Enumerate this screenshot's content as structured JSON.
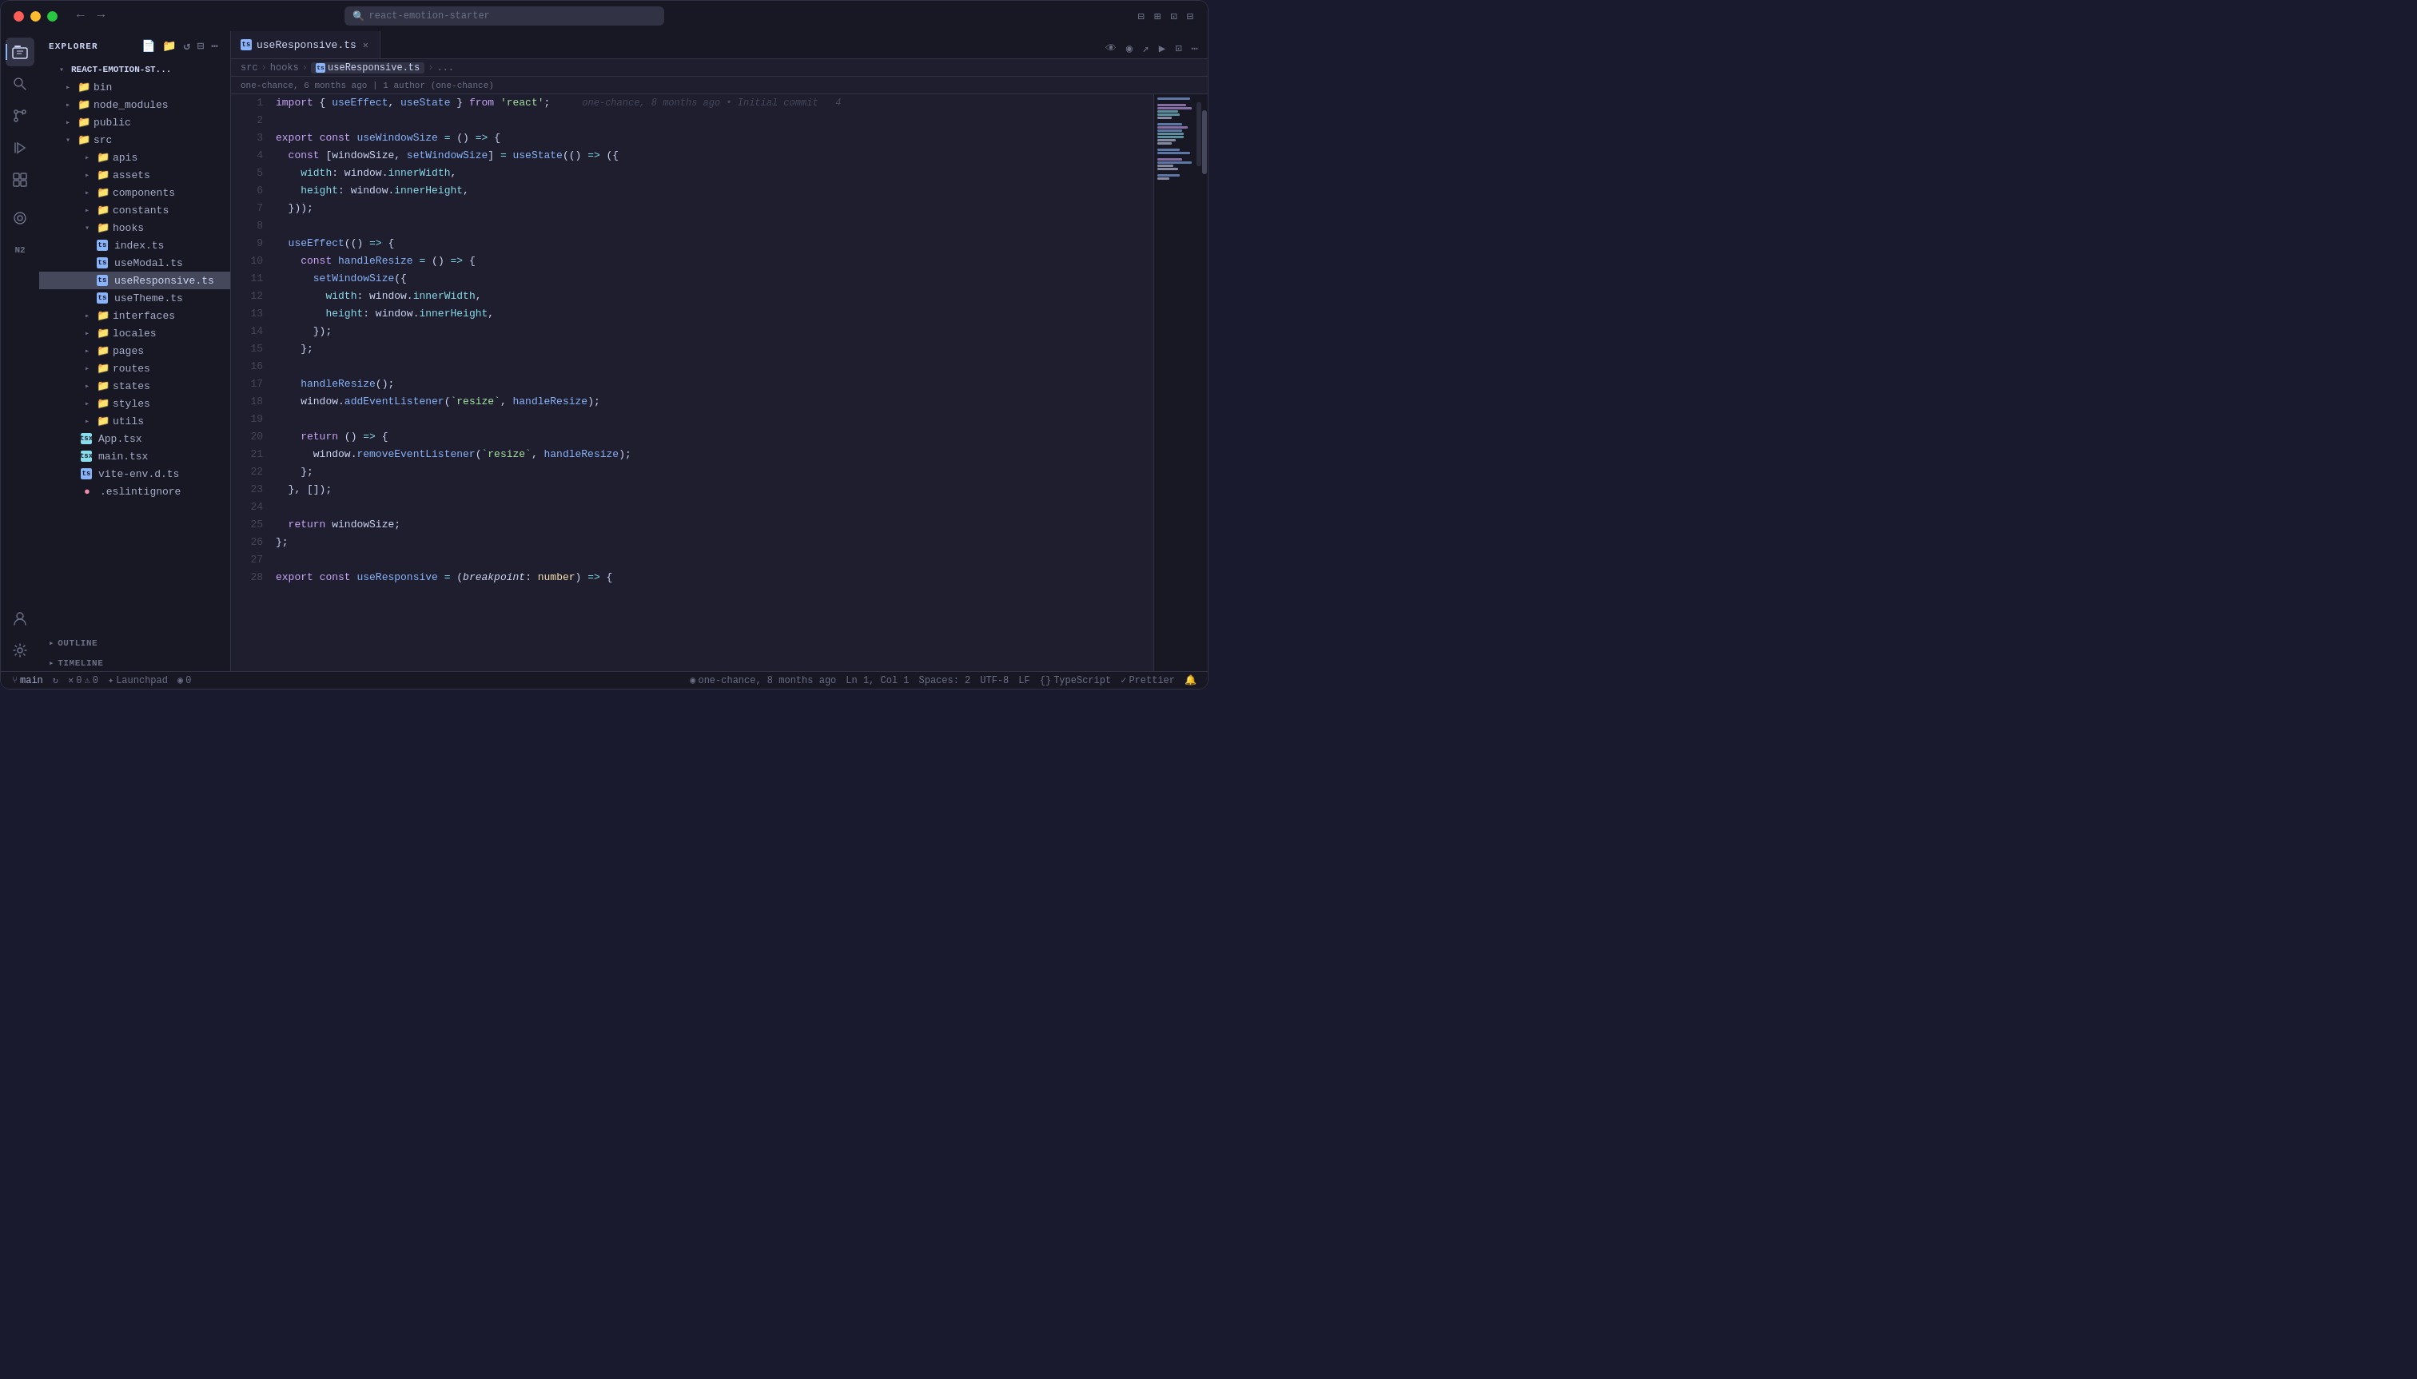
{
  "titlebar": {
    "search_placeholder": "react-emotion-starter",
    "nav_back": "←",
    "nav_forward": "→"
  },
  "activity_bar": {
    "items": [
      {
        "name": "explorer",
        "icon": "⬜",
        "active": true
      },
      {
        "name": "search",
        "icon": "🔍"
      },
      {
        "name": "source-control",
        "icon": "⑂"
      },
      {
        "name": "run-debug",
        "icon": "▷"
      },
      {
        "name": "extensions",
        "icon": "⊞"
      },
      {
        "name": "remote-explorer",
        "icon": "⊙"
      },
      {
        "name": "copilot",
        "icon": "◎"
      },
      {
        "name": "accounts",
        "icon": "👤"
      },
      {
        "name": "settings",
        "icon": "⚙"
      }
    ]
  },
  "sidebar": {
    "title": "EXPLORER",
    "root": "REACT-EMOTION-ST...",
    "tree": [
      {
        "id": "bin",
        "label": "bin",
        "type": "folder",
        "indent": 1,
        "expanded": false
      },
      {
        "id": "node_modules",
        "label": "node_modules",
        "type": "folder",
        "indent": 1,
        "expanded": false
      },
      {
        "id": "public",
        "label": "public",
        "type": "folder",
        "indent": 1,
        "expanded": false
      },
      {
        "id": "src",
        "label": "src",
        "type": "folder",
        "indent": 1,
        "expanded": true
      },
      {
        "id": "apis",
        "label": "apis",
        "type": "folder",
        "indent": 2,
        "expanded": false
      },
      {
        "id": "assets",
        "label": "assets",
        "type": "folder",
        "indent": 2,
        "expanded": false
      },
      {
        "id": "components",
        "label": "components",
        "type": "folder",
        "indent": 2,
        "expanded": false
      },
      {
        "id": "constants",
        "label": "constants",
        "type": "folder",
        "indent": 2,
        "expanded": false
      },
      {
        "id": "hooks",
        "label": "hooks",
        "type": "folder",
        "indent": 2,
        "expanded": true,
        "special": "hooks"
      },
      {
        "id": "index_ts",
        "label": "index.ts",
        "type": "file-ts",
        "indent": 3
      },
      {
        "id": "useModal_ts",
        "label": "useModal.ts",
        "type": "file-ts",
        "indent": 3
      },
      {
        "id": "useResponsive_ts",
        "label": "useResponsive.ts",
        "type": "file-ts",
        "indent": 3,
        "active": true
      },
      {
        "id": "useTheme_ts",
        "label": "useTheme.ts",
        "type": "file-ts",
        "indent": 3
      },
      {
        "id": "interfaces",
        "label": "interfaces",
        "type": "folder",
        "indent": 2,
        "expanded": false
      },
      {
        "id": "locales",
        "label": "locales",
        "type": "folder",
        "indent": 2,
        "expanded": false
      },
      {
        "id": "pages",
        "label": "pages",
        "type": "folder",
        "indent": 2,
        "expanded": false
      },
      {
        "id": "routes",
        "label": "routes",
        "type": "folder",
        "indent": 2,
        "expanded": false
      },
      {
        "id": "states",
        "label": "states",
        "type": "folder",
        "indent": 2,
        "expanded": false
      },
      {
        "id": "styles",
        "label": "styles",
        "type": "folder",
        "indent": 2,
        "expanded": false
      },
      {
        "id": "utils",
        "label": "utils",
        "type": "folder",
        "indent": 2,
        "expanded": false
      },
      {
        "id": "app_tsx",
        "label": "App.tsx",
        "type": "file-tsx",
        "indent": 2
      },
      {
        "id": "main_tsx",
        "label": "main.tsx",
        "type": "file-tsx",
        "indent": 2
      },
      {
        "id": "vite_env",
        "label": "vite-env.d.ts",
        "type": "file-ts",
        "indent": 2
      },
      {
        "id": "eslintrc",
        "label": ".eslintignore",
        "type": "file-dot",
        "indent": 2
      }
    ],
    "outline_label": "OUTLINE",
    "timeline_label": "TIMELINE"
  },
  "tab_bar": {
    "tabs": [
      {
        "id": "useResponsive",
        "label": "useResponsive.ts",
        "active": true,
        "icon": "ts"
      }
    ],
    "actions": [
      "👁",
      "👁‍🗨",
      "🔀",
      "▶",
      "⊟",
      "⋯"
    ]
  },
  "breadcrumb": {
    "parts": [
      "src",
      "hooks",
      "useResponsive.ts",
      "..."
    ]
  },
  "blame_info": {
    "text": "one-chance, 6 months ago | 1 author (one-chance)"
  },
  "code": {
    "lines": [
      {
        "num": 1,
        "content": "import { useEffect, useState } from 'react';",
        "blame": "one-chance, 8 months ago • Initial commit   4"
      },
      {
        "num": 2,
        "content": ""
      },
      {
        "num": 3,
        "content": "export const useWindowSize = () => {"
      },
      {
        "num": 4,
        "content": "  const [windowSize, setWindowSize] = useState(() => ({"
      },
      {
        "num": 5,
        "content": "    width: window.innerWidth,"
      },
      {
        "num": 6,
        "content": "    height: window.innerHeight,"
      },
      {
        "num": 7,
        "content": "  }));"
      },
      {
        "num": 8,
        "content": ""
      },
      {
        "num": 9,
        "content": "  useEffect(() => {"
      },
      {
        "num": 10,
        "content": "    const handleResize = () => {"
      },
      {
        "num": 11,
        "content": "      setWindowSize({"
      },
      {
        "num": 12,
        "content": "        width: window.innerWidth,"
      },
      {
        "num": 13,
        "content": "        height: window.innerHeight,"
      },
      {
        "num": 14,
        "content": "      });"
      },
      {
        "num": 15,
        "content": "    };"
      },
      {
        "num": 16,
        "content": ""
      },
      {
        "num": 17,
        "content": "    handleResize();"
      },
      {
        "num": 18,
        "content": "    window.addEventListener(`resize`, handleResize);"
      },
      {
        "num": 19,
        "content": ""
      },
      {
        "num": 20,
        "content": "    return () => {"
      },
      {
        "num": 21,
        "content": "      window.removeEventListener(`resize`, handleResize);"
      },
      {
        "num": 22,
        "content": "    };"
      },
      {
        "num": 23,
        "content": "  }, []);"
      },
      {
        "num": 24,
        "content": ""
      },
      {
        "num": 25,
        "content": "  return windowSize;"
      },
      {
        "num": 26,
        "content": "};"
      },
      {
        "num": 27,
        "content": ""
      },
      {
        "num": 28,
        "content": "export const useResponsive = (breakpoint: number) => {"
      }
    ]
  },
  "status_bar": {
    "branch": "main",
    "sync_icon": "↻",
    "errors": "0",
    "warnings": "0",
    "launchpad": "Launchpad",
    "issues": "0",
    "blame": "one-chance, 8 months ago",
    "cursor": "Ln 1, Col 1",
    "spaces": "Spaces: 2",
    "encoding": "UTF-8",
    "eol": "LF",
    "language": "TypeScript",
    "prettier": "Prettier"
  }
}
